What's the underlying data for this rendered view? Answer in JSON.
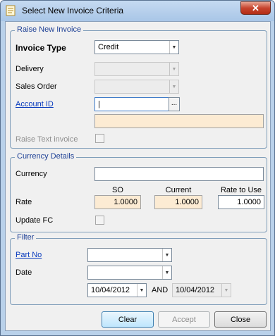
{
  "window": {
    "title": "Select New Invoice Criteria",
    "close_label": "✕"
  },
  "raise_group": {
    "legend": "Raise New Invoice",
    "invoice_type_label": "Invoice Type",
    "invoice_type_value": "Credit",
    "delivery_label": "Delivery",
    "sales_order_label": "Sales Order",
    "account_id_label": "Account ID",
    "account_id_value": "|",
    "account_lookup_label": "...",
    "raise_text_invoice_label": "Raise Text invoice"
  },
  "currency_group": {
    "legend": "Currency Details",
    "currency_label": "Currency",
    "rate_label": "Rate",
    "so_header": "SO",
    "current_header": "Current",
    "rate_to_use_header": "Rate to Use",
    "so_value": "1.0000",
    "current_value": "1.0000",
    "rate_to_use_value": "1.0000",
    "update_fc_label": "Update FC"
  },
  "filter_group": {
    "legend": "Filter",
    "part_no_label": "Part No",
    "date_label": "Date",
    "date_from": "10/04/2012",
    "and_label": "AND",
    "date_to": "10/04/2012"
  },
  "buttons": {
    "clear": "Clear",
    "accept": "Accept",
    "close": "Close"
  },
  "icons": {
    "combo_arrow": "▼"
  }
}
